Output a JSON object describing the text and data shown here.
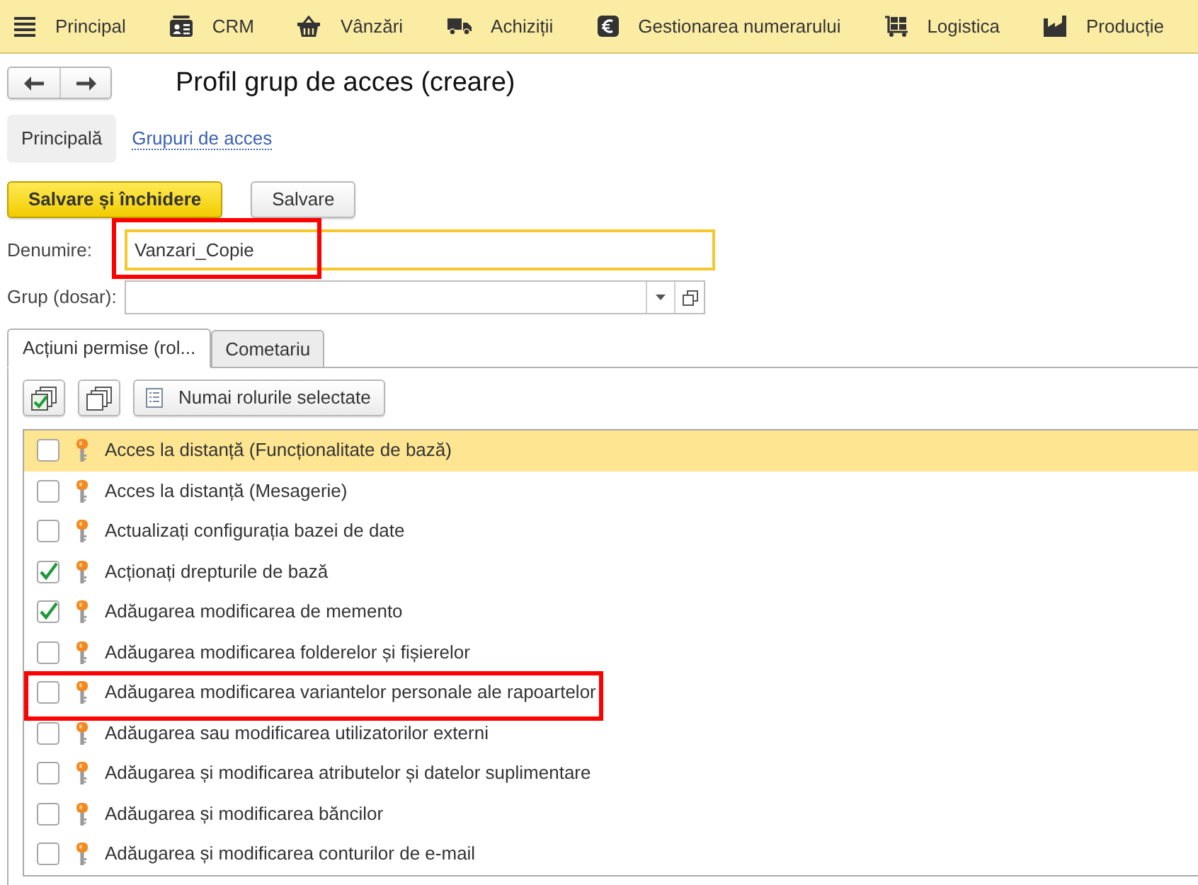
{
  "top_menu": [
    {
      "label": "Principal",
      "kind": "menu"
    },
    {
      "label": "CRM",
      "kind": "crm"
    },
    {
      "label": "Vânzări",
      "kind": "sales"
    },
    {
      "label": "Achiziții",
      "kind": "purchases"
    },
    {
      "label": "Gestionarea numerarului",
      "kind": "cash"
    },
    {
      "label": "Logistica",
      "kind": "logistics"
    },
    {
      "label": "Producție",
      "kind": "production"
    }
  ],
  "title": "Profil grup de acces (creare)",
  "sections": [
    {
      "label": "Principală",
      "selected": true
    },
    {
      "label": "Grupuri de acces",
      "selected": false
    }
  ],
  "actions": [
    {
      "label": "Salvare și închidere",
      "kind": "primary"
    },
    {
      "label": "Salvare",
      "kind": "secondary"
    }
  ],
  "fields": [
    {
      "label": "Denumire:",
      "kind": "text",
      "value": "Vanzari_Copie",
      "focused": true,
      "annotated": true
    },
    {
      "label": "Grup (dosar):",
      "kind": "select",
      "focused": false,
      "annotated": false
    }
  ],
  "tabs": [
    {
      "label": "Acțiuni permise (rol...",
      "selected": true
    },
    {
      "label": "Cometariu",
      "selected": false
    }
  ],
  "toolbar": [
    {
      "kind": "check_all"
    },
    {
      "kind": "uncheck_all"
    },
    {
      "kind": "filter",
      "label": "Numai rolurile selectate"
    }
  ],
  "roles": [
    {
      "label": "Acces la distanță (Funcționalitate de bază)",
      "checked": false,
      "selected": true,
      "annotated": false
    },
    {
      "label": "Acces la distanță (Mesagerie)",
      "checked": false,
      "selected": false,
      "annotated": false
    },
    {
      "label": "Actualizați configurația bazei de date",
      "checked": false,
      "selected": false,
      "annotated": false
    },
    {
      "label": "Acționați drepturile de bază",
      "checked": true,
      "selected": false,
      "annotated": false
    },
    {
      "label": "Adăugarea modificarea de memento",
      "checked": true,
      "selected": false,
      "annotated": false
    },
    {
      "label": "Adăugarea modificarea folderelor și fișierelor",
      "checked": false,
      "selected": false,
      "annotated": false
    },
    {
      "label": "Adăugarea modificarea variantelor personale ale rapoartelor",
      "checked": false,
      "selected": false,
      "annotated": true
    },
    {
      "label": "Adăugarea sau modificarea utilizatorilor externi",
      "checked": false,
      "selected": false,
      "annotated": false
    },
    {
      "label": "Adăugarea și modificarea atributelor și datelor suplimentare",
      "checked": false,
      "selected": false,
      "annotated": false
    },
    {
      "label": "Adăugarea și modificarea băncilor",
      "checked": false,
      "selected": false,
      "annotated": false
    },
    {
      "label": "Adăugarea și modificarea conturilor de e-mail",
      "checked": false,
      "selected": false,
      "annotated": false
    }
  ]
}
